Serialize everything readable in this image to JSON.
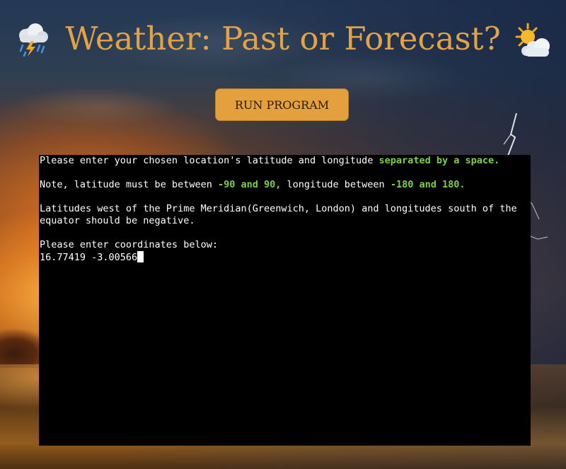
{
  "page": {
    "title": "Weather: Past or Forecast?",
    "left_icon": "storm-cloud-icon",
    "right_icon": "sun-behind-cloud-icon"
  },
  "actions": {
    "run_label": "RUN PROGRAM"
  },
  "terminal": {
    "line1_pre": "Please enter your chosen location's latitude and longitude ",
    "line1_hl": "separated by a space.",
    "line2_pre": "Note, latitude must be between ",
    "line2_hl1": "-90 and 90,",
    "line2_mid": " longitude between ",
    "line2_hl2": "-180 and 180.",
    "line3": "Latitudes west of the Prime Meridian(Greenwich, London) and longitudes south of the equator should be negative.",
    "line4": "Please enter coordinates below:",
    "input_value": "16.77419 -3.00566"
  },
  "colors": {
    "title": "#e3a245",
    "button_bg": "#e3a03c",
    "highlight": "#7bd148",
    "terminal_bg": "#000000"
  }
}
